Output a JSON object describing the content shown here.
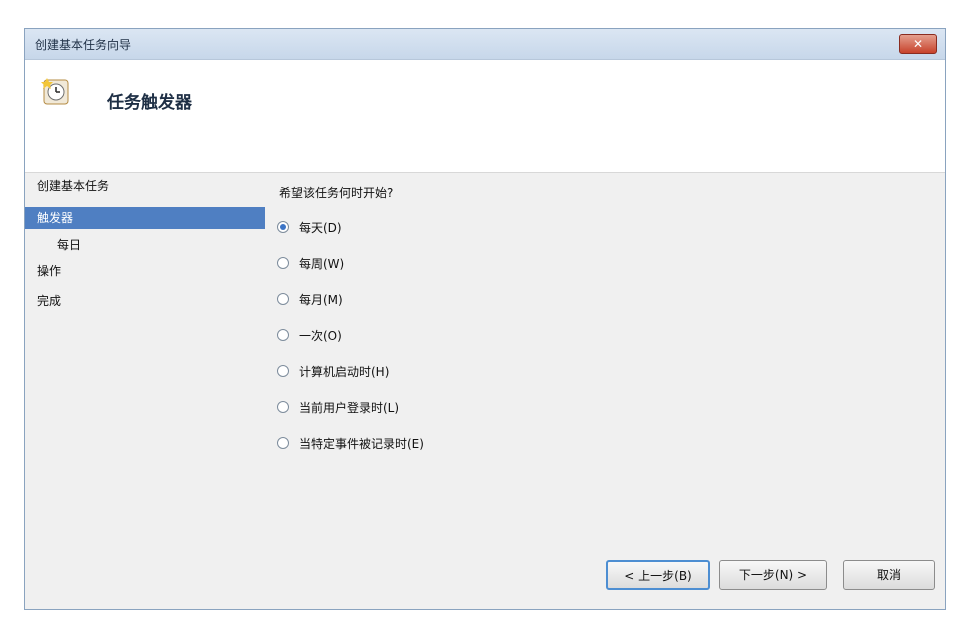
{
  "window": {
    "title": "创建基本任务向导",
    "close_label": "✕"
  },
  "header": {
    "title": "任务触发器",
    "icon": "clock-task-icon"
  },
  "nav": {
    "items": [
      {
        "label": "创建基本任务"
      },
      {
        "label": "触发器"
      },
      {
        "label": "每日"
      },
      {
        "label": "操作"
      },
      {
        "label": "完成"
      }
    ]
  },
  "content": {
    "question": "希望该任务何时开始?",
    "options": [
      {
        "label": "每天(D)",
        "checked": true
      },
      {
        "label": "每周(W)",
        "checked": false
      },
      {
        "label": "每月(M)",
        "checked": false
      },
      {
        "label": "一次(O)",
        "checked": false
      },
      {
        "label": "计算机启动时(H)",
        "checked": false
      },
      {
        "label": "当前用户登录时(L)",
        "checked": false
      },
      {
        "label": "当特定事件被记录时(E)",
        "checked": false
      }
    ]
  },
  "buttons": {
    "back": "< 上一步(B)",
    "next": "下一步(N) >",
    "cancel": "取消"
  },
  "colors": {
    "selection": "#4f7fc2",
    "radio_checked": "#3b74c6",
    "default_button_border": "#4d8ed2"
  }
}
